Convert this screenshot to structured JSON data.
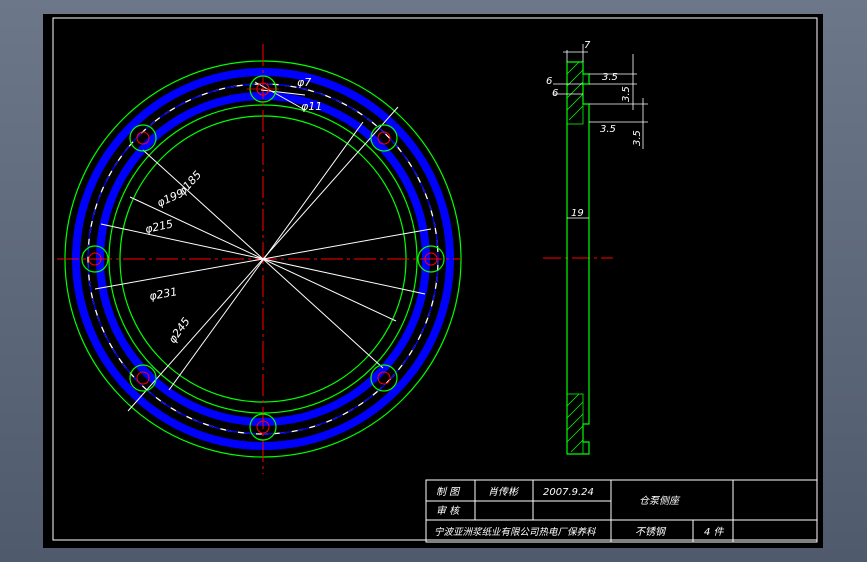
{
  "drawing": {
    "dimensions": {
      "d7": "φ7",
      "d11": "φ11",
      "d185": "φ185",
      "d199": "φ199",
      "d215": "φ215",
      "d231": "φ231",
      "d245": "φ245"
    },
    "section_dims": {
      "top7": "7",
      "d35a": "3.5",
      "d35b": "3.5",
      "d35c": "3.5",
      "d35d": "3.5",
      "d6a": "6",
      "d6b": "6",
      "d19": "19",
      "d35e": "3.5"
    }
  },
  "title_block": {
    "r1c1": "制 图",
    "r1c2": "肖传彬",
    "r1c3": "2007.9.24",
    "r2c1": "审 核",
    "part_name": "仓泵侧座",
    "company": "宁波亚洲浆纸业有限公司热电厂保养科",
    "material": "不锈钢",
    "quantity": "4 件"
  },
  "colors": {
    "green": "#00ff00",
    "blue": "#0000ff",
    "red": "#ff0000",
    "white": "#ffffff"
  }
}
